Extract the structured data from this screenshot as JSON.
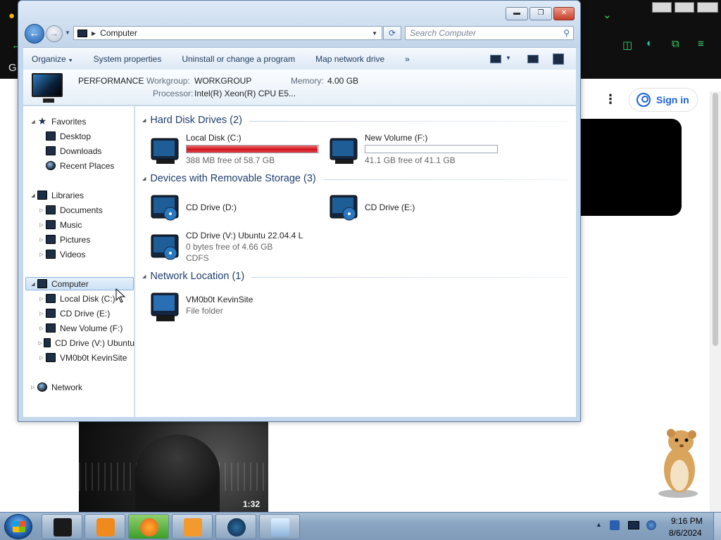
{
  "window": {
    "title_buttons": {
      "minimize": "▬",
      "restore": "❐",
      "close": "✕"
    },
    "address": "Computer",
    "search_placeholder": "Search Computer"
  },
  "commands": [
    "Organize",
    "System properties",
    "Uninstall or change a program",
    "Map network drive",
    "»"
  ],
  "details": {
    "computer_name": "PERFORMANCE",
    "workgroup_label": "Workgroup:",
    "workgroup": "WORKGROUP",
    "memory_label": "Memory:",
    "memory": "4.00 GB",
    "processor_label": "Processor:",
    "processor": "Intel(R) Xeon(R) CPU E5..."
  },
  "tree": {
    "favorites": "Favorites",
    "desktop": "Desktop",
    "downloads": "Downloads",
    "recent_places": "Recent Places",
    "libraries": "Libraries",
    "documents": "Documents",
    "music": "Music",
    "pictures": "Pictures",
    "videos": "Videos",
    "computer": "Computer",
    "local_disk": "Local Disk (C:)",
    "cd_e": "CD Drive (E:)",
    "new_volume": "New Volume (F:)",
    "cd_v": "CD Drive (V:) Ubuntu",
    "kevinsite": "VM0b0t KevinSite",
    "network": "Network"
  },
  "groups": {
    "hdd": "Hard Disk Drives (2)",
    "removable": "Devices with Removable Storage (3)",
    "network": "Network Location (1)"
  },
  "drives": {
    "c": {
      "name": "Local Disk (C:)",
      "free": "388 MB free of 58.7 GB",
      "used_fraction": 0.994
    },
    "f": {
      "name": "New Volume (F:)",
      "free": "41.1 GB free of 41.1 GB",
      "used_fraction": 0.0
    },
    "d": {
      "name": "CD Drive (D:)"
    },
    "e": {
      "name": "CD Drive (E:)"
    },
    "v": {
      "name": "CD Drive (V:) Ubuntu 22.04.4 L",
      "free": "0 bytes free of 4.66 GB",
      "fs": "CDFS"
    },
    "net": {
      "name": "VM0b0t KevinSite",
      "type": "File folder"
    }
  },
  "browser": {
    "sign_in": "Sign in",
    "video_time": "1:32"
  },
  "taskbar": {
    "clock_time": "9:16 PM",
    "clock_date": "8/6/2024",
    "tray_expand": "▲"
  },
  "colors": {
    "drive_full_bar": "#d1141d",
    "accent_group_header": "#1e3f6e"
  }
}
